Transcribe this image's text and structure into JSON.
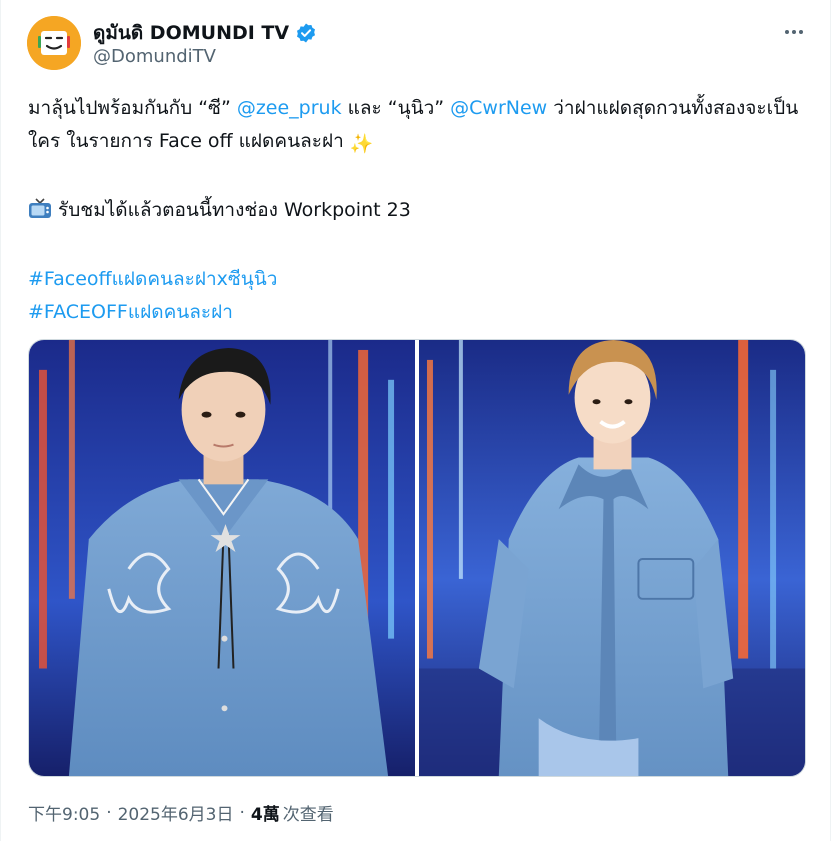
{
  "author": {
    "display_name": "ดูมันดิ DOMUNDI TV",
    "handle": "@DomundiTV",
    "avatar_icon": "domundi-logo",
    "verified_icon": "verified-badge-icon",
    "brand_color": "#f5a623"
  },
  "tweet": {
    "line1_pre": "มาลุ้นไปพร้อมกันกับ “ซี” ",
    "mention1": "@zee_pruk",
    "line1_mid": " และ “นุนิว” ",
    "mention2": "@CwrNew",
    "line1_post": " ว่าฝาแฝดสุดกวนทั้งสองจะเป็นใคร ในรายการ Face off แฝดคนละฝา ",
    "sparkle_emoji": "✨",
    "tv_emoji": "📺",
    "line2": " รับชมได้แล้วตอนนี้ทางช่อง Workpoint 23",
    "hashtag1": "#Faceoffแฝดคนละฝาxซีนุนิว",
    "hashtag2": "#FACEOFFแฝดคนละฝา"
  },
  "meta": {
    "time": "下午9:05",
    "sep1": "·",
    "date": "2025年6月3日",
    "sep2": "·",
    "views_count": "4萬",
    "views_label": "次查看"
  },
  "colors": {
    "link": "#1d9bf0",
    "secondary_text": "#536471"
  }
}
